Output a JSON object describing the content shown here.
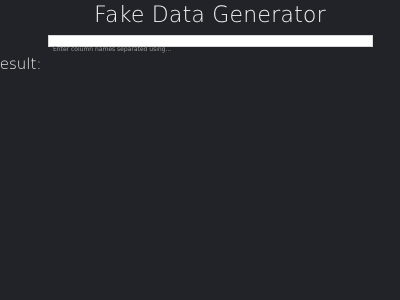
{
  "app": {
    "title": "Fake Data Generator"
  },
  "input": {
    "value": "",
    "placeholder": "Enter column names separated using..."
  },
  "result": {
    "label": "Result:"
  },
  "colors": {
    "background": "#222328",
    "text": "#f4f4f4",
    "input_background": "#ffffff"
  }
}
